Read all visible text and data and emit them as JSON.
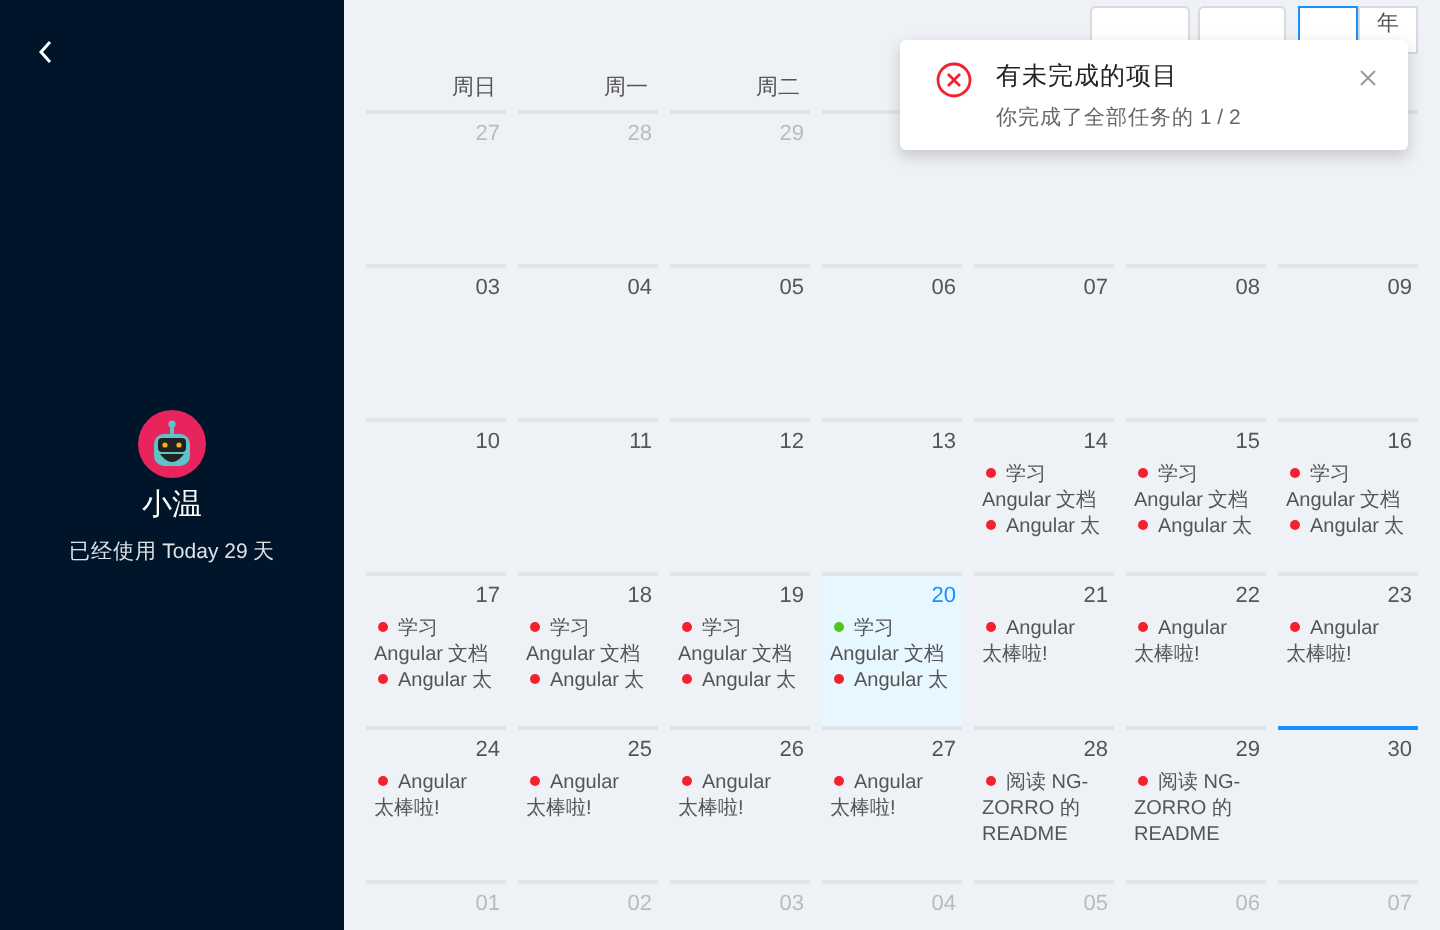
{
  "sidebar": {
    "user_name": "小温",
    "usage": "已经使用 Today 29 天"
  },
  "toolbar": {
    "modes": [
      {
        "selected": true
      },
      {
        "label": "年",
        "selected": false
      }
    ]
  },
  "weekdays": [
    "周日",
    "周一",
    "周二"
  ],
  "weeks": [
    [
      {
        "date": "27",
        "muted": true,
        "today": false,
        "selected": false
      },
      {
        "date": "28",
        "muted": true,
        "today": false,
        "selected": false
      },
      {
        "date": "29",
        "muted": true,
        "today": false,
        "selected": false
      }
    ],
    [
      {
        "date": "03",
        "muted": false,
        "today": false,
        "selected": false
      },
      {
        "date": "04",
        "muted": false,
        "today": false,
        "selected": false
      },
      {
        "date": "05",
        "muted": false,
        "today": false,
        "selected": false
      },
      {
        "date": "06",
        "muted": false,
        "today": false,
        "selected": false
      },
      {
        "date": "07",
        "muted": false,
        "today": false,
        "selected": false
      },
      {
        "date": "08",
        "muted": false,
        "today": false,
        "selected": false
      },
      {
        "date": "09",
        "muted": false,
        "today": false,
        "selected": false
      }
    ],
    [
      {
        "date": "10",
        "muted": false,
        "today": false,
        "selected": false
      },
      {
        "date": "11",
        "muted": false,
        "today": false,
        "selected": false
      },
      {
        "date": "12",
        "muted": false,
        "today": false,
        "selected": false
      },
      {
        "date": "13",
        "muted": false,
        "today": false,
        "selected": false
      },
      {
        "date": "14",
        "muted": false,
        "today": false,
        "selected": false,
        "events": [
          {
            "text": "学习 Angular 文档",
            "color": "#f5222d"
          },
          {
            "text": "Angular 太",
            "color": "#f5222d"
          }
        ]
      },
      {
        "date": "15",
        "muted": false,
        "today": false,
        "selected": false,
        "events": [
          {
            "text": "学习 Angular 文档",
            "color": "#f5222d"
          },
          {
            "text": "Angular 太",
            "color": "#f5222d"
          }
        ]
      },
      {
        "date": "16",
        "muted": false,
        "today": false,
        "selected": false,
        "events": [
          {
            "text": "学习 Angular 文档",
            "color": "#f5222d"
          },
          {
            "text": "Angular 太",
            "color": "#f5222d"
          }
        ]
      }
    ],
    [
      {
        "date": "17",
        "muted": false,
        "today": false,
        "selected": false,
        "events": [
          {
            "text": "学习 Angular 文档",
            "color": "#f5222d"
          },
          {
            "text": "Angular 太",
            "color": "#f5222d"
          }
        ]
      },
      {
        "date": "18",
        "muted": false,
        "today": false,
        "selected": false,
        "events": [
          {
            "text": "学习 Angular 文档",
            "color": "#f5222d"
          },
          {
            "text": "Angular 太",
            "color": "#f5222d"
          }
        ]
      },
      {
        "date": "19",
        "muted": false,
        "today": false,
        "selected": false,
        "events": [
          {
            "text": "学习 Angular 文档",
            "color": "#f5222d"
          },
          {
            "text": "Angular 太",
            "color": "#f5222d"
          }
        ]
      },
      {
        "date": "20",
        "muted": false,
        "today": true,
        "selected": false,
        "events": [
          {
            "text": "学习 Angular 文档",
            "color": "#52c41a"
          },
          {
            "text": "Angular 太",
            "color": "#f5222d"
          }
        ]
      },
      {
        "date": "21",
        "muted": false,
        "today": false,
        "selected": false,
        "events": [
          {
            "text": "Angular 太棒啦!",
            "color": "#f5222d"
          }
        ]
      },
      {
        "date": "22",
        "muted": false,
        "today": false,
        "selected": false,
        "events": [
          {
            "text": "Angular 太棒啦!",
            "color": "#f5222d"
          }
        ]
      },
      {
        "date": "23",
        "muted": false,
        "today": false,
        "selected": false,
        "events": [
          {
            "text": "Angular 太棒啦!",
            "color": "#f5222d"
          }
        ]
      }
    ],
    [
      {
        "date": "24",
        "muted": false,
        "today": false,
        "selected": false,
        "events": [
          {
            "text": "Angular 太棒啦!",
            "color": "#f5222d"
          }
        ]
      },
      {
        "date": "25",
        "muted": false,
        "today": false,
        "selected": false,
        "events": [
          {
            "text": "Angular 太棒啦!",
            "color": "#f5222d"
          }
        ]
      },
      {
        "date": "26",
        "muted": false,
        "today": false,
        "selected": false,
        "events": [
          {
            "text": "Angular 太棒啦!",
            "color": "#f5222d"
          }
        ]
      },
      {
        "date": "27",
        "muted": false,
        "today": false,
        "selected": false,
        "events": [
          {
            "text": "Angular 太棒啦!",
            "color": "#f5222d"
          }
        ]
      },
      {
        "date": "28",
        "muted": false,
        "today": false,
        "selected": false,
        "events": [
          {
            "text": "阅读 NG-ZORRO 的 README",
            "color": "#f5222d"
          }
        ]
      },
      {
        "date": "29",
        "muted": false,
        "today": false,
        "selected": false,
        "events": [
          {
            "text": "阅读 NG-ZORRO 的 README",
            "color": "#f5222d"
          }
        ]
      },
      {
        "date": "30",
        "muted": false,
        "today": false,
        "selected": true
      }
    ],
    [
      {
        "date": "01",
        "muted": true,
        "today": false,
        "selected": false
      },
      {
        "date": "02",
        "muted": true,
        "today": false,
        "selected": false
      },
      {
        "date": "03",
        "muted": true,
        "today": false,
        "selected": false
      },
      {
        "date": "04",
        "muted": true,
        "today": false,
        "selected": false
      },
      {
        "date": "05",
        "muted": true,
        "today": false,
        "selected": false
      },
      {
        "date": "06",
        "muted": true,
        "today": false,
        "selected": false
      },
      {
        "date": "07",
        "muted": true,
        "today": false,
        "selected": false
      }
    ]
  ],
  "notification": {
    "title": "有未完成的项目",
    "message": "你完成了全部任务的 1 / 2"
  }
}
